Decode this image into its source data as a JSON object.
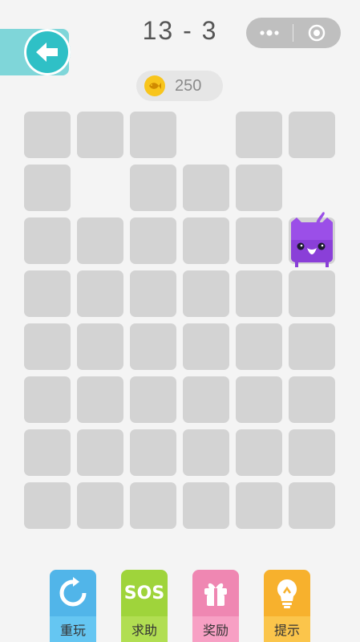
{
  "header": {
    "level": "13 - 3",
    "back_icon": "arrow-left-icon",
    "capsule": {
      "more_icon": "more-dots-icon",
      "close_icon": "target-circle-icon"
    }
  },
  "coins": {
    "value": "250",
    "icon": "fish-coin-icon",
    "color": "#f8c51c"
  },
  "board": {
    "rows": 8,
    "cols": 6,
    "layout": [
      "111011",
      "101110",
      "111111",
      "111111",
      "111111",
      "111111",
      "111111",
      "111111"
    ],
    "cat": {
      "row": 2,
      "col": 5,
      "color": "#9b4fe8"
    }
  },
  "actions": [
    {
      "label": "重玩",
      "icon": "replay-icon",
      "color": "#51b5e9"
    },
    {
      "label": "求助",
      "icon": "sos-icon",
      "badge": "SOS",
      "color": "#9fd43b"
    },
    {
      "label": "奖励",
      "icon": "gift-icon",
      "color": "#ef87b2"
    },
    {
      "label": "提示",
      "icon": "lightbulb-icon",
      "color": "#f7b12d"
    }
  ]
}
